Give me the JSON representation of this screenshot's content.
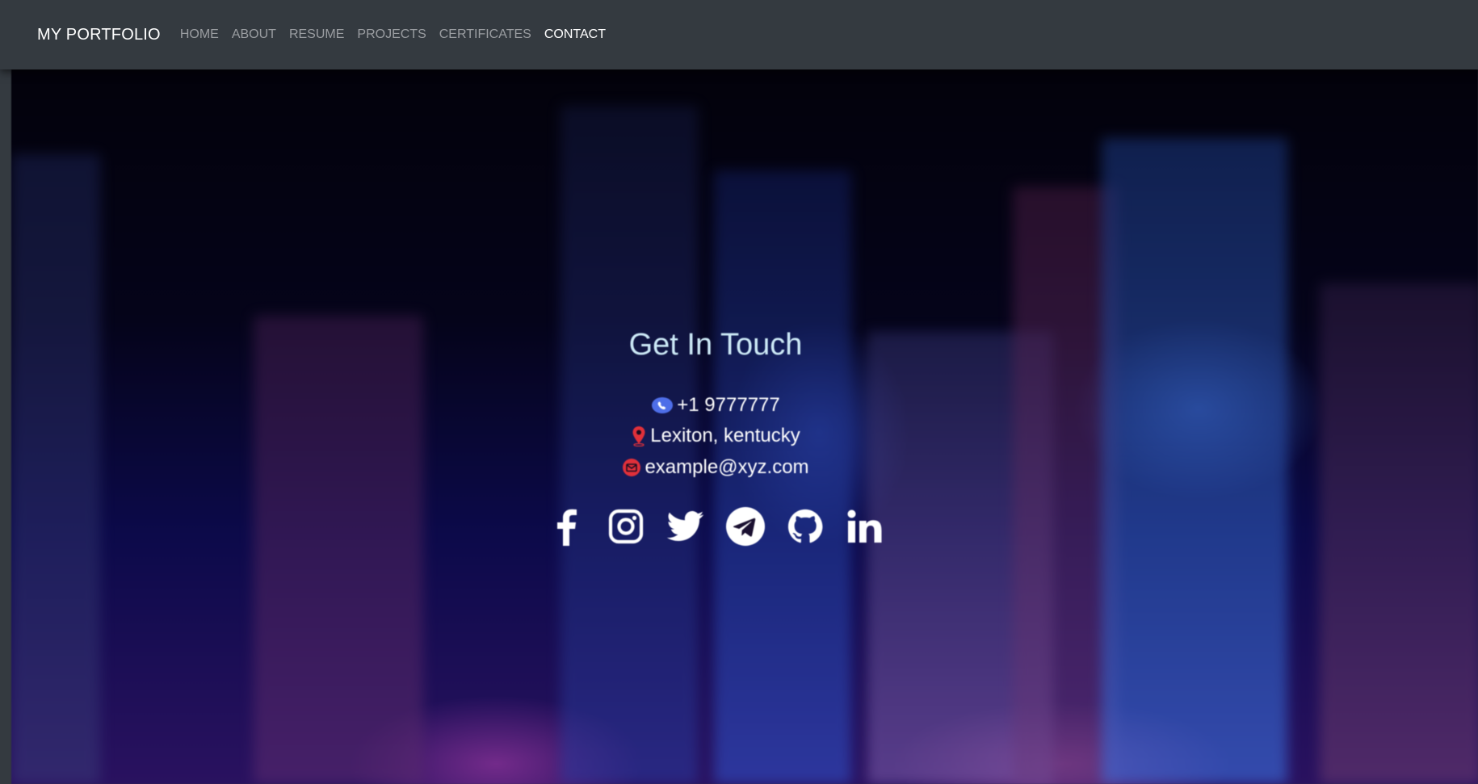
{
  "nav": {
    "brand": "MY PORTFOLIO",
    "links": [
      "HOME",
      "ABOUT",
      "RESUME",
      "PROJECTS",
      "CERTIFICATES",
      "CONTACT"
    ],
    "active": "CONTACT"
  },
  "contact": {
    "title": "Get In Touch",
    "phone": "+1 9777777",
    "location": "Lexiton, kentucky",
    "email": "example@xyz.com"
  },
  "icons": {
    "phone": "phone-icon",
    "location": "map-pin-icon",
    "email": "envelope-icon",
    "socials": [
      "facebook-icon",
      "instagram-icon",
      "twitter-icon",
      "telegram-icon",
      "github-icon",
      "linkedin-icon"
    ]
  },
  "colors": {
    "navbar": "#343a40",
    "title": "#cdeaf7",
    "phone_icon": "#4e6ee8",
    "location_icon": "#e0303a",
    "email_icon": "#e0303a"
  }
}
